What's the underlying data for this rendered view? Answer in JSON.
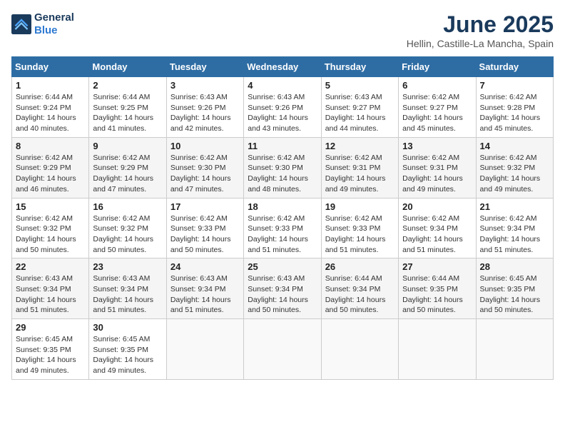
{
  "header": {
    "logo_text_general": "General",
    "logo_text_blue": "Blue",
    "title": "June 2025",
    "subtitle": "Hellin, Castille-La Mancha, Spain"
  },
  "calendar": {
    "days_of_week": [
      "Sunday",
      "Monday",
      "Tuesday",
      "Wednesday",
      "Thursday",
      "Friday",
      "Saturday"
    ],
    "weeks": [
      [
        {
          "day": "",
          "info": ""
        },
        {
          "day": "2",
          "info": "Sunrise: 6:44 AM\nSunset: 9:25 PM\nDaylight: 14 hours\nand 41 minutes."
        },
        {
          "day": "3",
          "info": "Sunrise: 6:43 AM\nSunset: 9:26 PM\nDaylight: 14 hours\nand 42 minutes."
        },
        {
          "day": "4",
          "info": "Sunrise: 6:43 AM\nSunset: 9:26 PM\nDaylight: 14 hours\nand 43 minutes."
        },
        {
          "day": "5",
          "info": "Sunrise: 6:43 AM\nSunset: 9:27 PM\nDaylight: 14 hours\nand 44 minutes."
        },
        {
          "day": "6",
          "info": "Sunrise: 6:42 AM\nSunset: 9:27 PM\nDaylight: 14 hours\nand 45 minutes."
        },
        {
          "day": "7",
          "info": "Sunrise: 6:42 AM\nSunset: 9:28 PM\nDaylight: 14 hours\nand 45 minutes."
        }
      ],
      [
        {
          "day": "8",
          "info": "Sunrise: 6:42 AM\nSunset: 9:29 PM\nDaylight: 14 hours\nand 46 minutes."
        },
        {
          "day": "9",
          "info": "Sunrise: 6:42 AM\nSunset: 9:29 PM\nDaylight: 14 hours\nand 47 minutes."
        },
        {
          "day": "10",
          "info": "Sunrise: 6:42 AM\nSunset: 9:30 PM\nDaylight: 14 hours\nand 47 minutes."
        },
        {
          "day": "11",
          "info": "Sunrise: 6:42 AM\nSunset: 9:30 PM\nDaylight: 14 hours\nand 48 minutes."
        },
        {
          "day": "12",
          "info": "Sunrise: 6:42 AM\nSunset: 9:31 PM\nDaylight: 14 hours\nand 49 minutes."
        },
        {
          "day": "13",
          "info": "Sunrise: 6:42 AM\nSunset: 9:31 PM\nDaylight: 14 hours\nand 49 minutes."
        },
        {
          "day": "14",
          "info": "Sunrise: 6:42 AM\nSunset: 9:32 PM\nDaylight: 14 hours\nand 49 minutes."
        }
      ],
      [
        {
          "day": "15",
          "info": "Sunrise: 6:42 AM\nSunset: 9:32 PM\nDaylight: 14 hours\nand 50 minutes."
        },
        {
          "day": "16",
          "info": "Sunrise: 6:42 AM\nSunset: 9:32 PM\nDaylight: 14 hours\nand 50 minutes."
        },
        {
          "day": "17",
          "info": "Sunrise: 6:42 AM\nSunset: 9:33 PM\nDaylight: 14 hours\nand 50 minutes."
        },
        {
          "day": "18",
          "info": "Sunrise: 6:42 AM\nSunset: 9:33 PM\nDaylight: 14 hours\nand 51 minutes."
        },
        {
          "day": "19",
          "info": "Sunrise: 6:42 AM\nSunset: 9:33 PM\nDaylight: 14 hours\nand 51 minutes."
        },
        {
          "day": "20",
          "info": "Sunrise: 6:42 AM\nSunset: 9:34 PM\nDaylight: 14 hours\nand 51 minutes."
        },
        {
          "day": "21",
          "info": "Sunrise: 6:42 AM\nSunset: 9:34 PM\nDaylight: 14 hours\nand 51 minutes."
        }
      ],
      [
        {
          "day": "22",
          "info": "Sunrise: 6:43 AM\nSunset: 9:34 PM\nDaylight: 14 hours\nand 51 minutes."
        },
        {
          "day": "23",
          "info": "Sunrise: 6:43 AM\nSunset: 9:34 PM\nDaylight: 14 hours\nand 51 minutes."
        },
        {
          "day": "24",
          "info": "Sunrise: 6:43 AM\nSunset: 9:34 PM\nDaylight: 14 hours\nand 51 minutes."
        },
        {
          "day": "25",
          "info": "Sunrise: 6:43 AM\nSunset: 9:34 PM\nDaylight: 14 hours\nand 50 minutes."
        },
        {
          "day": "26",
          "info": "Sunrise: 6:44 AM\nSunset: 9:34 PM\nDaylight: 14 hours\nand 50 minutes."
        },
        {
          "day": "27",
          "info": "Sunrise: 6:44 AM\nSunset: 9:35 PM\nDaylight: 14 hours\nand 50 minutes."
        },
        {
          "day": "28",
          "info": "Sunrise: 6:45 AM\nSunset: 9:35 PM\nDaylight: 14 hours\nand 50 minutes."
        }
      ],
      [
        {
          "day": "29",
          "info": "Sunrise: 6:45 AM\nSunset: 9:35 PM\nDaylight: 14 hours\nand 49 minutes."
        },
        {
          "day": "30",
          "info": "Sunrise: 6:45 AM\nSunset: 9:35 PM\nDaylight: 14 hours\nand 49 minutes."
        },
        {
          "day": "",
          "info": ""
        },
        {
          "day": "",
          "info": ""
        },
        {
          "day": "",
          "info": ""
        },
        {
          "day": "",
          "info": ""
        },
        {
          "day": "",
          "info": ""
        }
      ]
    ],
    "week1_sun": {
      "day": "1",
      "info": "Sunrise: 6:44 AM\nSunset: 9:24 PM\nDaylight: 14 hours\nand 40 minutes."
    }
  }
}
